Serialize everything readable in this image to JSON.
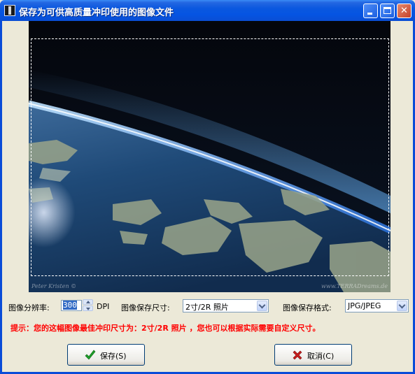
{
  "window": {
    "title": "保存为可供高质量冲印使用的图像文件"
  },
  "preview": {
    "watermark_left": "Peter Kristen ©",
    "watermark_right": "www.TERRADreams.de"
  },
  "controls": {
    "resolution_label": "图像分辨率:",
    "resolution_value": "300",
    "resolution_unit": "DPI",
    "size_label": "图像保存尺寸:",
    "size_value": "2寸/2R 照片",
    "format_label": "图像保存格式:",
    "format_value": "JPG/JPEG"
  },
  "hint": "提示：您的这幅图像最佳冲印尺寸为：2寸/2R 照片 ，您也可以根据实际需要自定义尺寸。",
  "buttons": {
    "save_label": "保存(S)",
    "cancel_label": "取消(C)"
  },
  "colors": {
    "titlebar": "#0A58DF",
    "hint_text": "#FF0000",
    "save_icon": "#1E9E2A",
    "cancel_icon": "#C81E1E"
  }
}
